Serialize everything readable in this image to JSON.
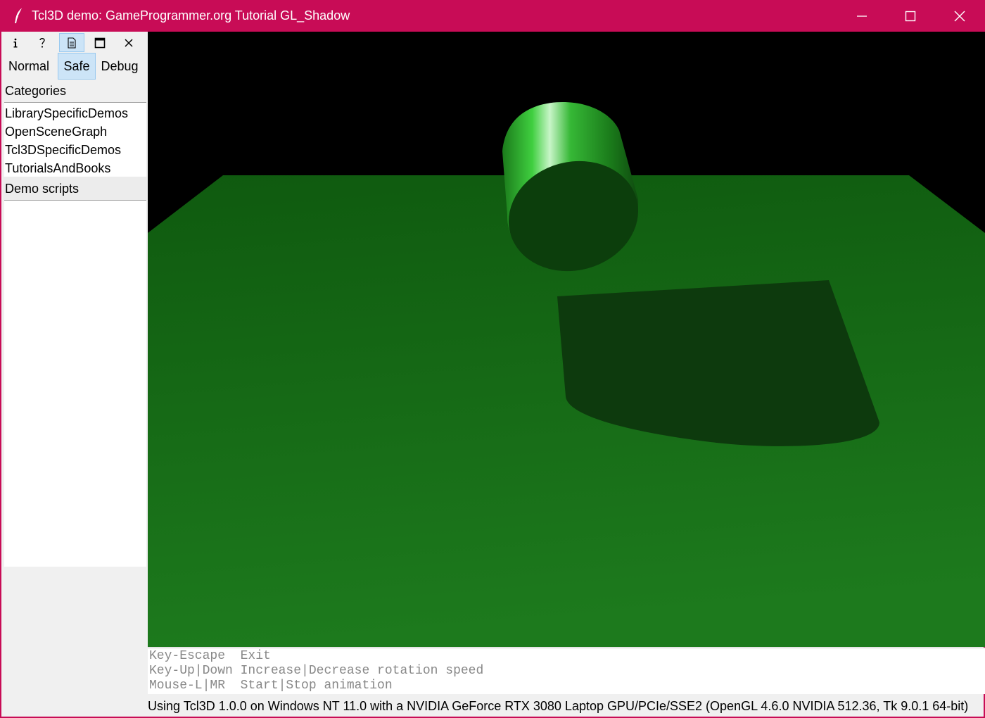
{
  "window": {
    "title": "Tcl3D demo: GameProgrammer.org Tutorial GL_Shadow",
    "accent_color": "#c80c56",
    "controls": [
      "minimize-icon",
      "maximize-icon",
      "close-icon"
    ]
  },
  "toolbar": {
    "icons": [
      {
        "name": "info-icon",
        "glyph": "i"
      },
      {
        "name": "help-icon",
        "glyph": "?"
      },
      {
        "name": "document-icon",
        "glyph": "▤"
      },
      {
        "name": "fullscreen-icon",
        "glyph": "☐"
      },
      {
        "name": "close-demo-icon",
        "glyph": "✕"
      }
    ]
  },
  "modes": {
    "normal": "Normal",
    "safe": "Safe",
    "debug": "Debug",
    "selected": "Safe"
  },
  "categories": {
    "label": "Categories",
    "items": [
      "LibrarySpecificDemos",
      "OpenSceneGraph",
      "Tcl3DSpecificDemos",
      "TutorialsAndBooks"
    ]
  },
  "demo_scripts": {
    "label": "Demo scripts",
    "items": []
  },
  "help": {
    "lines": [
      "Key-Escape  Exit",
      "Key-Up|Down Increase|Decrease rotation speed",
      "Mouse-L|MR  Start|Stop animation"
    ]
  },
  "status": {
    "text": "Using Tcl3D 1.0.0 on Windows NT 11.0 with a NVIDIA GeForce RTX 3080 Laptop GPU/PCIe/SSE2 (OpenGL 4.6.0 NVIDIA 512.36, Tk 9.0.1 64-bit)"
  },
  "scene": {
    "background_color": "#000000",
    "floor_color": "#1a6e1a",
    "cylinder_color": "#2fc42f",
    "shadow_color": "#0c360c"
  }
}
